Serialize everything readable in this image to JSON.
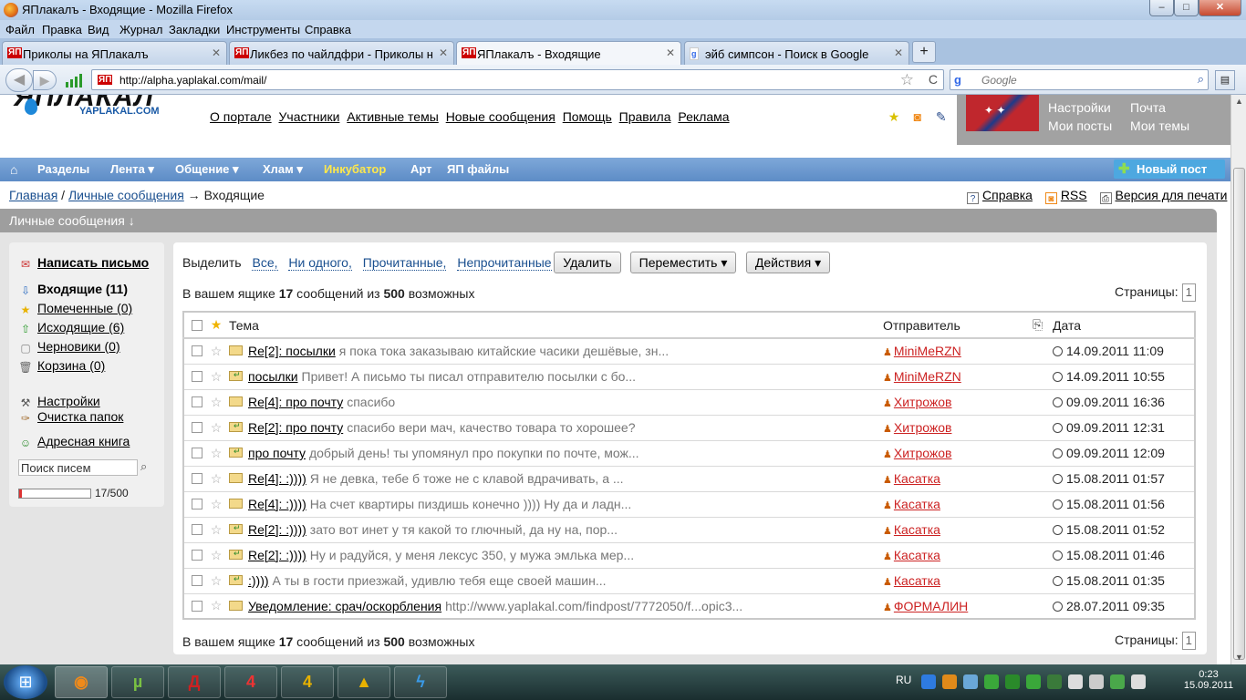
{
  "window": {
    "title": "ЯПлакалъ - Входящие - Mozilla Firefox",
    "min_label": "–",
    "max_label": "□",
    "close_label": "✕"
  },
  "menu": [
    "Файл",
    "Правка",
    "Вид",
    "Журнал",
    "Закладки",
    "Инструменты",
    "Справка"
  ],
  "tabs": [
    {
      "label": "Приколы на ЯПлакалъ",
      "favicon": "ЯП"
    },
    {
      "label": "Ликбез по чайлдфри - Приколы на ЯПлакалъ",
      "favicon": "ЯП"
    },
    {
      "label": "ЯПлакалъ - Входящие",
      "favicon": "ЯП"
    },
    {
      "label": "эйб симпсон - Поиск в Google",
      "favicon": "g"
    }
  ],
  "tab_close": "✕",
  "new_tab": "+",
  "nav": {
    "back": "◀",
    "forward": "▶",
    "url": "http://alpha.yaplakal.com/mail/",
    "url_favicon": "ЯП",
    "search_placeholder": "Google",
    "search_logo": "g",
    "bookmark_star": "☆",
    "reload": "C",
    "search_go": "⌕",
    "ext_label": "▤"
  },
  "site": {
    "logo_text": "ЯПЛАКАЛ",
    "logo_sub": "YAPLAKAL.COM",
    "top_links": [
      "О портале",
      "Участники",
      "Активные темы",
      "Новые сообщения",
      "Помощь",
      "Правила",
      "Реклама"
    ],
    "header_icons": [
      {
        "name": "star-icon",
        "glyph": "★",
        "color": "#d9c100"
      },
      {
        "name": "rss-icon",
        "glyph": "◙",
        "color": "#f08a1a"
      },
      {
        "name": "pencil-icon",
        "glyph": "✎",
        "color": "#2a4d8c"
      }
    ],
    "user_links": {
      "settings": "Настройки",
      "mail": "Почта",
      "my_posts": "Мои посты",
      "my_topics": "Мои темы"
    }
  },
  "main_nav": {
    "home_icon": "⌂",
    "items": [
      {
        "label": "Разделы"
      },
      {
        "label": "Лента ▾"
      },
      {
        "label": "Общение ▾"
      },
      {
        "label": "Хлам ▾"
      },
      {
        "label": "Инкубатор",
        "highlight": true
      },
      {
        "label": "Арт"
      },
      {
        "label": "ЯП файлы"
      }
    ],
    "new_post": "Новый пост",
    "new_post_icon": "✚"
  },
  "breadcrumb": {
    "home": "Главная",
    "sep1": " / ",
    "pm": "Личные сообщения",
    "sep2": " → ",
    "current": "Входящие"
  },
  "page_tools": {
    "help": "Справка",
    "rss": "RSS",
    "print": "Версия для печати",
    "help_icon": "?",
    "rss_icon": "◙",
    "print_icon": "⎙"
  },
  "section_title": "Личные сообщения ↓",
  "sidebar": {
    "compose": "Написать письмо",
    "folders": [
      {
        "label": "Входящие (11)",
        "icon": "⇩",
        "bold": true
      },
      {
        "label": "Помеченные (0)",
        "icon": "★"
      },
      {
        "label": "Исходящие (6)",
        "icon": "⇧"
      },
      {
        "label": "Черновики (0)",
        "icon": "▢"
      },
      {
        "label": "Корзина (0)",
        "icon": "🗑"
      }
    ],
    "settings": "Настройки",
    "cleanup": "Очистка папок",
    "addressbook": "Адресная книга",
    "search_value": "Поиск писем",
    "search_icon": "⌕",
    "quota_text": "17/500",
    "quota_fraction": 0.034
  },
  "toolbar": {
    "select_label": "Выделить",
    "select_options": [
      "Все,",
      "Ни одного,",
      "Прочитанные,",
      "Непрочитанные"
    ],
    "delete": "Удалить",
    "move": "Переместить ▾",
    "actions": "Действия ▾"
  },
  "summary": {
    "prefix": "В вашем ящике ",
    "count": "17",
    "middle": " сообщений из ",
    "max": "500",
    "suffix": " возможных",
    "pages_label": "Страницы:",
    "page": "1"
  },
  "table": {
    "headers": {
      "subject": "Тема",
      "sender": "Отправитель",
      "attach_icon": "⎘",
      "date": "Дата",
      "star": "★"
    },
    "rows": [
      {
        "subject": "Re[2]: посылки",
        "preview": "я пока тока заказываю китайские часики дешёвые, зн...",
        "sender": "MiniMeRZN",
        "date": "14.09.2011 11:09",
        "replied": false
      },
      {
        "subject": "посылки",
        "preview": "Привет! А письмо ты писал отправителю посылки с бо...",
        "sender": "MiniMeRZN",
        "date": "14.09.2011 10:55",
        "replied": true
      },
      {
        "subject": "Re[4]: про почту",
        "preview": "спасибо",
        "sender": "Хитрожов",
        "date": "09.09.2011 16:36",
        "replied": false
      },
      {
        "subject": "Re[2]: про почту",
        "preview": "спасибо вери мач, качество товара то хорошее?",
        "sender": "Хитрожов",
        "date": "09.09.2011 12:31",
        "replied": true
      },
      {
        "subject": "про почту",
        "preview": "добрый день! ты упомянул про покупки по почте, мож...",
        "sender": "Хитрожов",
        "date": "09.09.2011 12:09",
        "replied": true
      },
      {
        "subject": "Re[4]: :))))",
        "preview": "Я не девка, тебе б тоже не с клавой вдрачивать, а ...",
        "sender": "Касатка",
        "date": "15.08.2011 01:57",
        "replied": false
      },
      {
        "subject": "Re[4]: :))))",
        "preview": "На счет квартиры пиздишь конечно )))) Ну да и ладн...",
        "sender": "Касатка",
        "date": "15.08.2011 01:56",
        "replied": false
      },
      {
        "subject": "Re[2]: :))))",
        "preview": "зато вот инет у тя какой то глючный, да ну на, пор...",
        "sender": "Касатка",
        "date": "15.08.2011 01:52",
        "replied": true
      },
      {
        "subject": "Re[2]: :))))",
        "preview": "Ну и радуйся, у меня лексус 350, у мужа эмлька мер...",
        "sender": "Касатка",
        "date": "15.08.2011 01:46",
        "replied": true
      },
      {
        "subject": ":))))",
        "preview": "А ты в гости приезжай, удивлю тебя еще своей машин...",
        "sender": "Касатка",
        "date": "15.08.2011 01:35",
        "replied": true
      },
      {
        "subject": "Уведомление: срач/оскорбления",
        "preview": "http://www.yaplakal.com/findpost/7772050/f...opic3...",
        "sender": "ФОРМАЛИН",
        "date": "28.07.2011 09:35",
        "replied": false
      }
    ]
  },
  "taskbar": {
    "start": "⊞",
    "apps": [
      {
        "name": "firefox",
        "glyph": "◉",
        "color": "#f08a1a",
        "active": true
      },
      {
        "name": "utorrent",
        "glyph": "µ",
        "color": "#7ac143",
        "active": false
      },
      {
        "name": "game-red",
        "glyph": "Д",
        "color": "#c22",
        "active": false
      },
      {
        "name": "left4dead",
        "glyph": "4",
        "color": "#e33",
        "active": false
      },
      {
        "name": "left4dead2",
        "glyph": "4",
        "color": "#e8b200",
        "active": false
      },
      {
        "name": "aimp",
        "glyph": "▲",
        "color": "#e8b200",
        "active": false
      },
      {
        "name": "qip",
        "glyph": "ϟ",
        "color": "#3a9ae8",
        "active": false
      }
    ],
    "lang": "RU",
    "tray_colors": [
      "#2e7be0",
      "#e08a1a",
      "#6aa8d8",
      "#3aa83a",
      "#2a8a2a",
      "#3aa83a",
      "#3a7a3a",
      "#ddd",
      "#ccc",
      "#4aa84a",
      "#ddd"
    ],
    "time": "0:23",
    "date": "15.09.2011"
  }
}
